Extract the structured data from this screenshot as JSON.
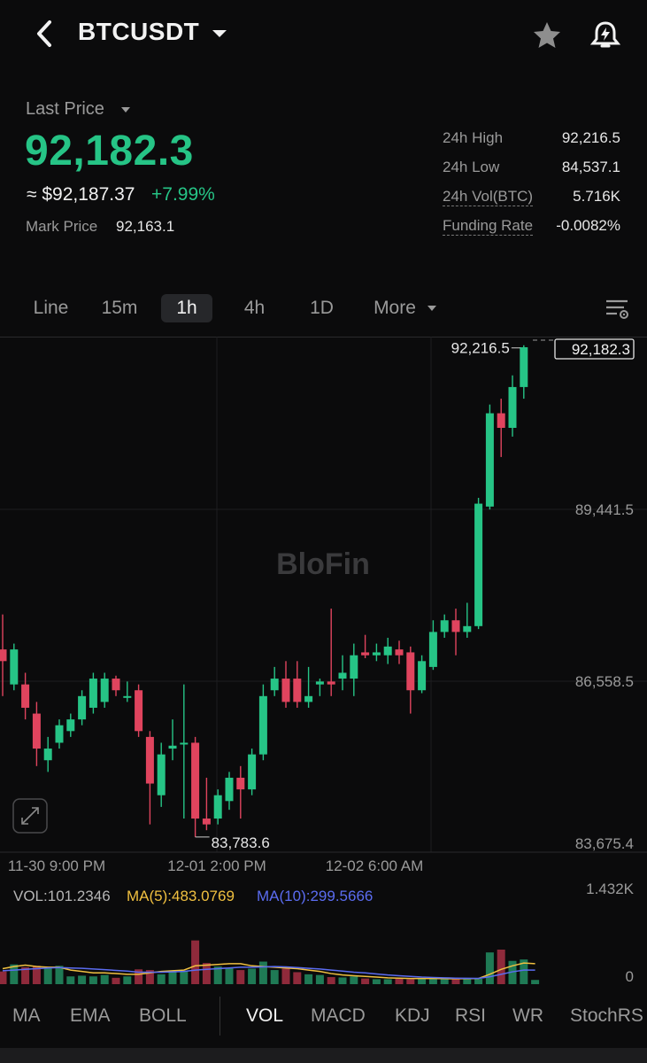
{
  "header": {
    "symbol": "BTCUSDT",
    "icons": [
      "back-arrow-icon",
      "chevron-down-icon",
      "star-icon",
      "bell-icon"
    ]
  },
  "ticker": {
    "last_price_label": "Last Price",
    "last_price": "92,182.3",
    "usd_value": "≈ $92,187.37",
    "change_pct": "+7.99%",
    "mark_price_label": "Mark Price",
    "mark_price": "92,163.1"
  },
  "stats": [
    {
      "label": "24h High",
      "value": "92,216.5"
    },
    {
      "label": "24h Low",
      "value": "84,537.1"
    },
    {
      "label": "24h Vol(BTC)",
      "value": "5.716K"
    },
    {
      "label": "Funding Rate",
      "value": "-0.0082%"
    }
  ],
  "timeframes": [
    "Line",
    "15m",
    "1h",
    "4h",
    "1D",
    "More"
  ],
  "active_timeframe": "1h",
  "colors": {
    "up": "#26c486",
    "down": "#e0445e",
    "vol_up": "#1f7a55",
    "vol_down": "#8f2a3b",
    "ma5": "#f0c040",
    "ma10": "#5b6cf0",
    "background": "#0b0b0c"
  },
  "chart_data": {
    "type": "candlestick",
    "interval": "1h",
    "watermark": "BloFin",
    "price_axis_labels": [
      "92,182.3",
      "89,441.5",
      "86,558.5",
      "83,675.4"
    ],
    "time_axis_labels": [
      "11-30 9:00 PM",
      "12-01 2:00 PM",
      "12-02 6:00 AM"
    ],
    "ylim": [
      83675.4,
      92182.3
    ],
    "high_marker": "92,216.5",
    "low_marker": "83,783.6",
    "last_price_tag": "92,182.3",
    "candles": [
      {
        "o": 87000,
        "h": 87600,
        "l": 86200,
        "c": 86800
      },
      {
        "o": 86400,
        "h": 87100,
        "l": 86300,
        "c": 87000
      },
      {
        "o": 86400,
        "h": 86600,
        "l": 85800,
        "c": 86000
      },
      {
        "o": 85900,
        "h": 86100,
        "l": 85000,
        "c": 85300
      },
      {
        "o": 85100,
        "h": 85500,
        "l": 84900,
        "c": 85300
      },
      {
        "o": 85400,
        "h": 85800,
        "l": 85300,
        "c": 85700
      },
      {
        "o": 85600,
        "h": 85900,
        "l": 85500,
        "c": 85800
      },
      {
        "o": 85800,
        "h": 86300,
        "l": 85700,
        "c": 86200
      },
      {
        "o": 86000,
        "h": 86600,
        "l": 85900,
        "c": 86500
      },
      {
        "o": 86100,
        "h": 86600,
        "l": 86000,
        "c": 86500
      },
      {
        "o": 86500,
        "h": 86550,
        "l": 86200,
        "c": 86300
      },
      {
        "o": 86200,
        "h": 86450,
        "l": 86100,
        "c": 86200
      },
      {
        "o": 86300,
        "h": 86400,
        "l": 85500,
        "c": 85600
      },
      {
        "o": 85500,
        "h": 85600,
        "l": 84000,
        "c": 84700
      },
      {
        "o": 84500,
        "h": 85400,
        "l": 84300,
        "c": 85200
      },
      {
        "o": 85300,
        "h": 85800,
        "l": 85100,
        "c": 85350
      },
      {
        "o": 85400,
        "h": 86400,
        "l": 84100,
        "c": 85400
      },
      {
        "o": 85400,
        "h": 85500,
        "l": 83783.6,
        "c": 84100
      },
      {
        "o": 84100,
        "h": 84800,
        "l": 83900,
        "c": 84000
      },
      {
        "o": 84100,
        "h": 84600,
        "l": 84000,
        "c": 84500
      },
      {
        "o": 84400,
        "h": 84900,
        "l": 84250,
        "c": 84800
      },
      {
        "o": 84800,
        "h": 85000,
        "l": 84100,
        "c": 84600
      },
      {
        "o": 84600,
        "h": 85300,
        "l": 84500,
        "c": 85200
      },
      {
        "o": 85200,
        "h": 86400,
        "l": 85100,
        "c": 86200
      },
      {
        "o": 86300,
        "h": 86700,
        "l": 86200,
        "c": 86500
      },
      {
        "o": 86500,
        "h": 86800,
        "l": 86000,
        "c": 86100
      },
      {
        "o": 86500,
        "h": 86800,
        "l": 86000,
        "c": 86100
      },
      {
        "o": 86100,
        "h": 86700,
        "l": 86000,
        "c": 86200
      },
      {
        "o": 86400,
        "h": 86500,
        "l": 86200,
        "c": 86450
      },
      {
        "o": 86450,
        "h": 87700,
        "l": 86200,
        "c": 86400
      },
      {
        "o": 86500,
        "h": 86900,
        "l": 86300,
        "c": 86600
      },
      {
        "o": 86500,
        "h": 87100,
        "l": 86200,
        "c": 86900
      },
      {
        "o": 86950,
        "h": 87250,
        "l": 86850,
        "c": 86900
      },
      {
        "o": 86900,
        "h": 87100,
        "l": 86800,
        "c": 86950
      },
      {
        "o": 86900,
        "h": 87200,
        "l": 86750,
        "c": 87050
      },
      {
        "o": 87000,
        "h": 87150,
        "l": 86750,
        "c": 86900
      },
      {
        "o": 86950,
        "h": 87050,
        "l": 85900,
        "c": 86300
      },
      {
        "o": 86300,
        "h": 86900,
        "l": 86250,
        "c": 86800
      },
      {
        "o": 86700,
        "h": 87500,
        "l": 86650,
        "c": 87300
      },
      {
        "o": 87300,
        "h": 87600,
        "l": 87200,
        "c": 87500
      },
      {
        "o": 87500,
        "h": 87700,
        "l": 86900,
        "c": 87300
      },
      {
        "o": 87300,
        "h": 87800,
        "l": 87200,
        "c": 87400
      },
      {
        "o": 87400,
        "h": 89600,
        "l": 87350,
        "c": 89500
      },
      {
        "o": 89450,
        "h": 91200,
        "l": 89400,
        "c": 91050
      },
      {
        "o": 91050,
        "h": 91300,
        "l": 90300,
        "c": 90800
      },
      {
        "o": 90800,
        "h": 91700,
        "l": 90650,
        "c": 91500
      },
      {
        "o": 91500,
        "h": 92216.5,
        "l": 91300,
        "c": 92182.3
      }
    ]
  },
  "volume": {
    "vol_label": "VOL:101.2346",
    "ma5_label": "MA(5):483.0769",
    "ma10_label": "MA(10):299.5666",
    "axis_max": "1.432K",
    "axis_min": "0",
    "max_value": 1432,
    "bars": [
      180,
      280,
      240,
      260,
      230,
      260,
      110,
      120,
      110,
      130,
      90,
      110,
      210,
      200,
      140,
      180,
      180,
      620,
      300,
      250,
      230,
      200,
      220,
      320,
      200,
      220,
      170,
      140,
      130,
      100,
      95,
      110,
      80,
      70,
      70,
      80,
      70,
      75,
      80,
      75,
      80,
      80,
      75,
      450,
      490,
      330,
      350,
      60
    ],
    "ma5": [
      220,
      250,
      270,
      250,
      240,
      240,
      200,
      180,
      160,
      160,
      150,
      140,
      140,
      160,
      180,
      190,
      200,
      260,
      270,
      280,
      290,
      290,
      260,
      250,
      240,
      230,
      220,
      200,
      180,
      150,
      130,
      120,
      110,
      100,
      90,
      85,
      80,
      80,
      80,
      78,
      77,
      78,
      80,
      140,
      210,
      260,
      300,
      290
    ],
    "ma10": [
      190,
      200,
      210,
      220,
      230,
      235,
      230,
      225,
      215,
      205,
      195,
      185,
      170,
      170,
      170,
      175,
      180,
      200,
      210,
      220,
      230,
      240,
      240,
      245,
      250,
      245,
      235,
      225,
      215,
      200,
      185,
      170,
      160,
      145,
      130,
      120,
      110,
      100,
      95,
      90,
      85,
      83,
      82,
      105,
      140,
      175,
      200,
      200
    ]
  },
  "indicator_tabs": [
    "MA",
    "EMA",
    "BOLL",
    "VOL",
    "MACD",
    "KDJ",
    "RSI",
    "WR",
    "StochRS"
  ],
  "active_indicator": "VOL"
}
